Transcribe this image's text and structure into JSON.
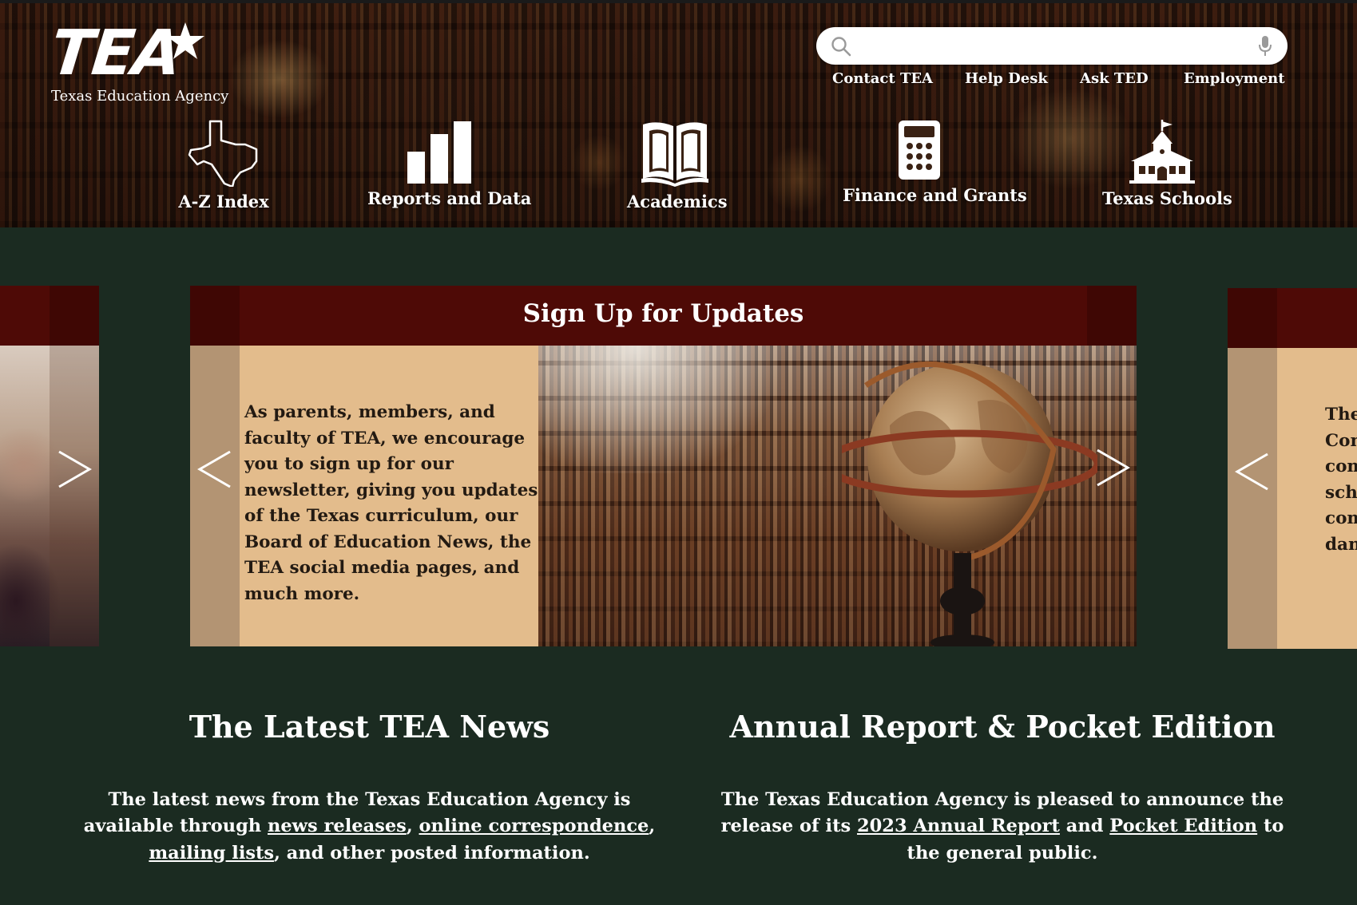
{
  "header": {
    "logo_text": "TEA",
    "logo_subtitle": "Texas Education Agency",
    "search": {
      "placeholder": ""
    },
    "top_links": [
      "Contact TEA",
      "Help Desk",
      "Ask TED",
      "Employment"
    ],
    "nav": [
      {
        "label": "A-Z Index",
        "icon": "texas-map-icon"
      },
      {
        "label": "Reports and Data",
        "icon": "bar-chart-icon"
      },
      {
        "label": "Academics",
        "icon": "open-book-icon"
      },
      {
        "label": "Finance and Grants",
        "icon": "calculator-icon"
      },
      {
        "label": "Texas Schools",
        "icon": "schoolhouse-icon"
      }
    ]
  },
  "carousel": {
    "active": {
      "title": "Sign Up for Updates",
      "text": "As parents, members, and faculty of TEA, we encourage you to sign up for our newsletter, giving you updates of the Texas curriculum, our Board of Education News, the TEA social media pages, and much more."
    },
    "next_partial_lines": [
      "The",
      "Con",
      "com",
      "scho",
      "com",
      "dan"
    ]
  },
  "news": {
    "title": "The Latest TEA News",
    "text_start": "The latest news from the Texas Education Agency is available through ",
    "links": [
      "news releases",
      "online correspondence",
      "mailing lists"
    ],
    "sep1": ", ",
    "sep2": ", ",
    "text_mid": ", and other posted information."
  },
  "report": {
    "title": "Annual Report & Pocket Edition",
    "text_start": "The Texas Education Agency is pleased to announce the release of its ",
    "link1": "2023 Annual Report",
    "and": " and ",
    "link2": "Pocket Edition",
    "text_end": " to the general public."
  },
  "colors": {
    "page_bg": "#1b2b21",
    "card_header": "#4e0a06",
    "card_body": "#e3bc8c",
    "side_strip": "#b39473"
  }
}
